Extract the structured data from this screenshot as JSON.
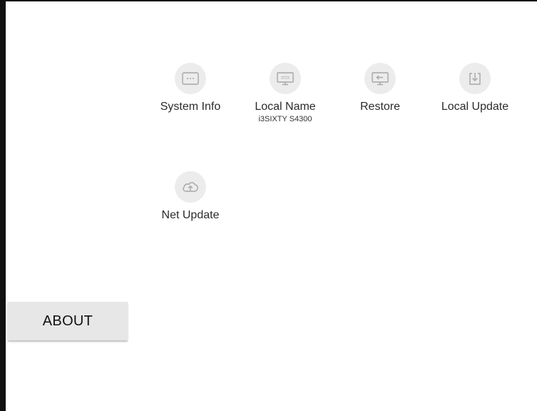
{
  "sidebar": {
    "about_label": "ABOUT"
  },
  "tiles": [
    {
      "label": "System Info",
      "sublabel": "",
      "icon": "dots-icon"
    },
    {
      "label": "Local Name",
      "sublabel": "i3SIXTY S4300",
      "icon": "monitor-icon"
    },
    {
      "label": "Restore",
      "sublabel": "",
      "icon": "restore-monitor-icon"
    },
    {
      "label": "Local Update",
      "sublabel": "",
      "icon": "download-tray-icon"
    },
    {
      "label": "Net Update",
      "sublabel": "",
      "icon": "cloud-upload-icon"
    }
  ],
  "colors": {
    "icon_circle": "#ececec",
    "icon_stroke": "#9a9a9a",
    "tab_background": "#e7e7e7"
  }
}
